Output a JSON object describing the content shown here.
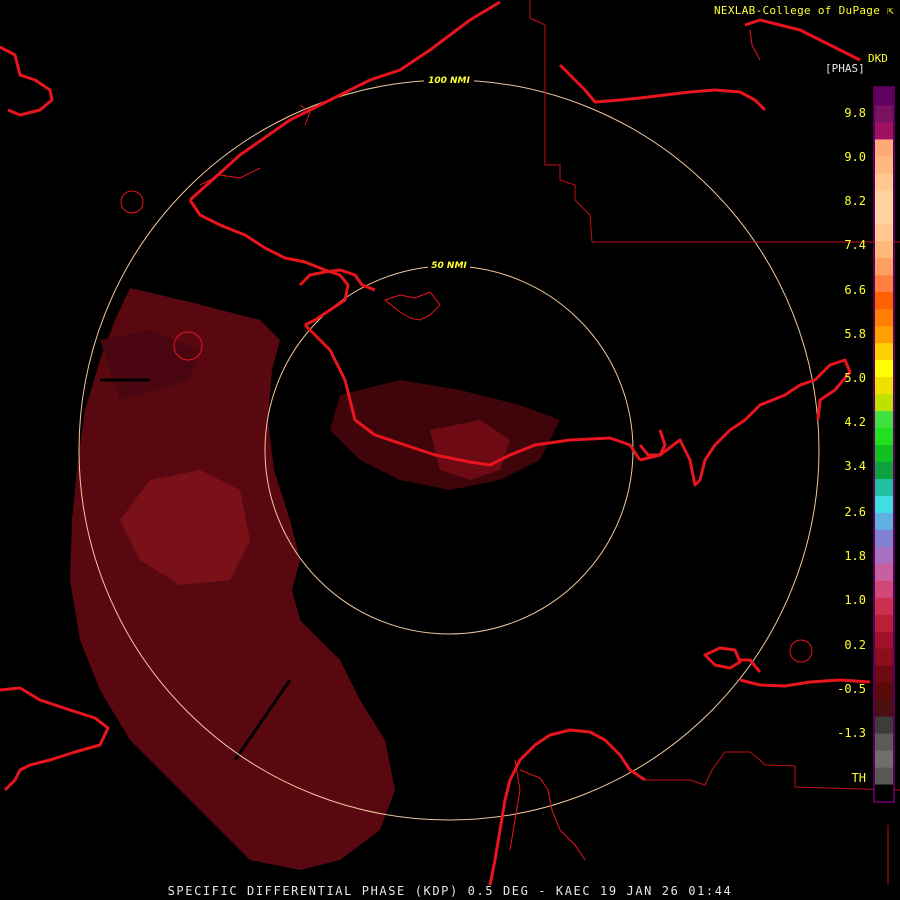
{
  "title": "SPECIFIC DIFFERENTIAL PHASE (KDP) 0.5 DEG - KAEC 19 JAN 26 01:44",
  "credit": "NEXLAB-College of DuPage",
  "credit_icon": "arrow-icon",
  "product_code": "DKD",
  "units": "[PHAS]",
  "range_rings": [
    {
      "label": "50 NMI"
    },
    {
      "label": "100 NMI"
    }
  ],
  "legend": {
    "ticks": [
      "9.8",
      "9.0",
      "8.2",
      "7.4",
      "6.6",
      "5.8",
      "5.0",
      "4.2",
      "3.4",
      "2.6",
      "1.8",
      "1.0",
      "0.2",
      "-0.5",
      "-1.3",
      "TH"
    ],
    "colors": [
      "#000000",
      "#585858",
      "#6e6e6e",
      "#5a5a5a",
      "#3c3c3c",
      "#4a1010",
      "#5a0a0a",
      "#6e0a14",
      "#8c0e1e",
      "#a0102a",
      "#b8203a",
      "#cc3050",
      "#d04878",
      "#c860a0",
      "#a870c0",
      "#8080d0",
      "#60b0e0",
      "#40e0e0",
      "#20c0a0",
      "#10a040",
      "#10c020",
      "#20e020",
      "#40e040",
      "#c0e000",
      "#f0e000",
      "#ffff00",
      "#ffd000",
      "#ffa000",
      "#ff8000",
      "#ff6000",
      "#ff8040",
      "#ffa060",
      "#ffb878",
      "#ffc890",
      "#ffd0a0",
      "#ffd0a0",
      "#ffc890",
      "#ffb880",
      "#ffa878",
      "#a01060",
      "#7a1060",
      "#600060"
    ]
  },
  "colors": {
    "map_lines": "#e8141e",
    "ring": "#f0c8a0",
    "echo": "#6e0a14"
  }
}
